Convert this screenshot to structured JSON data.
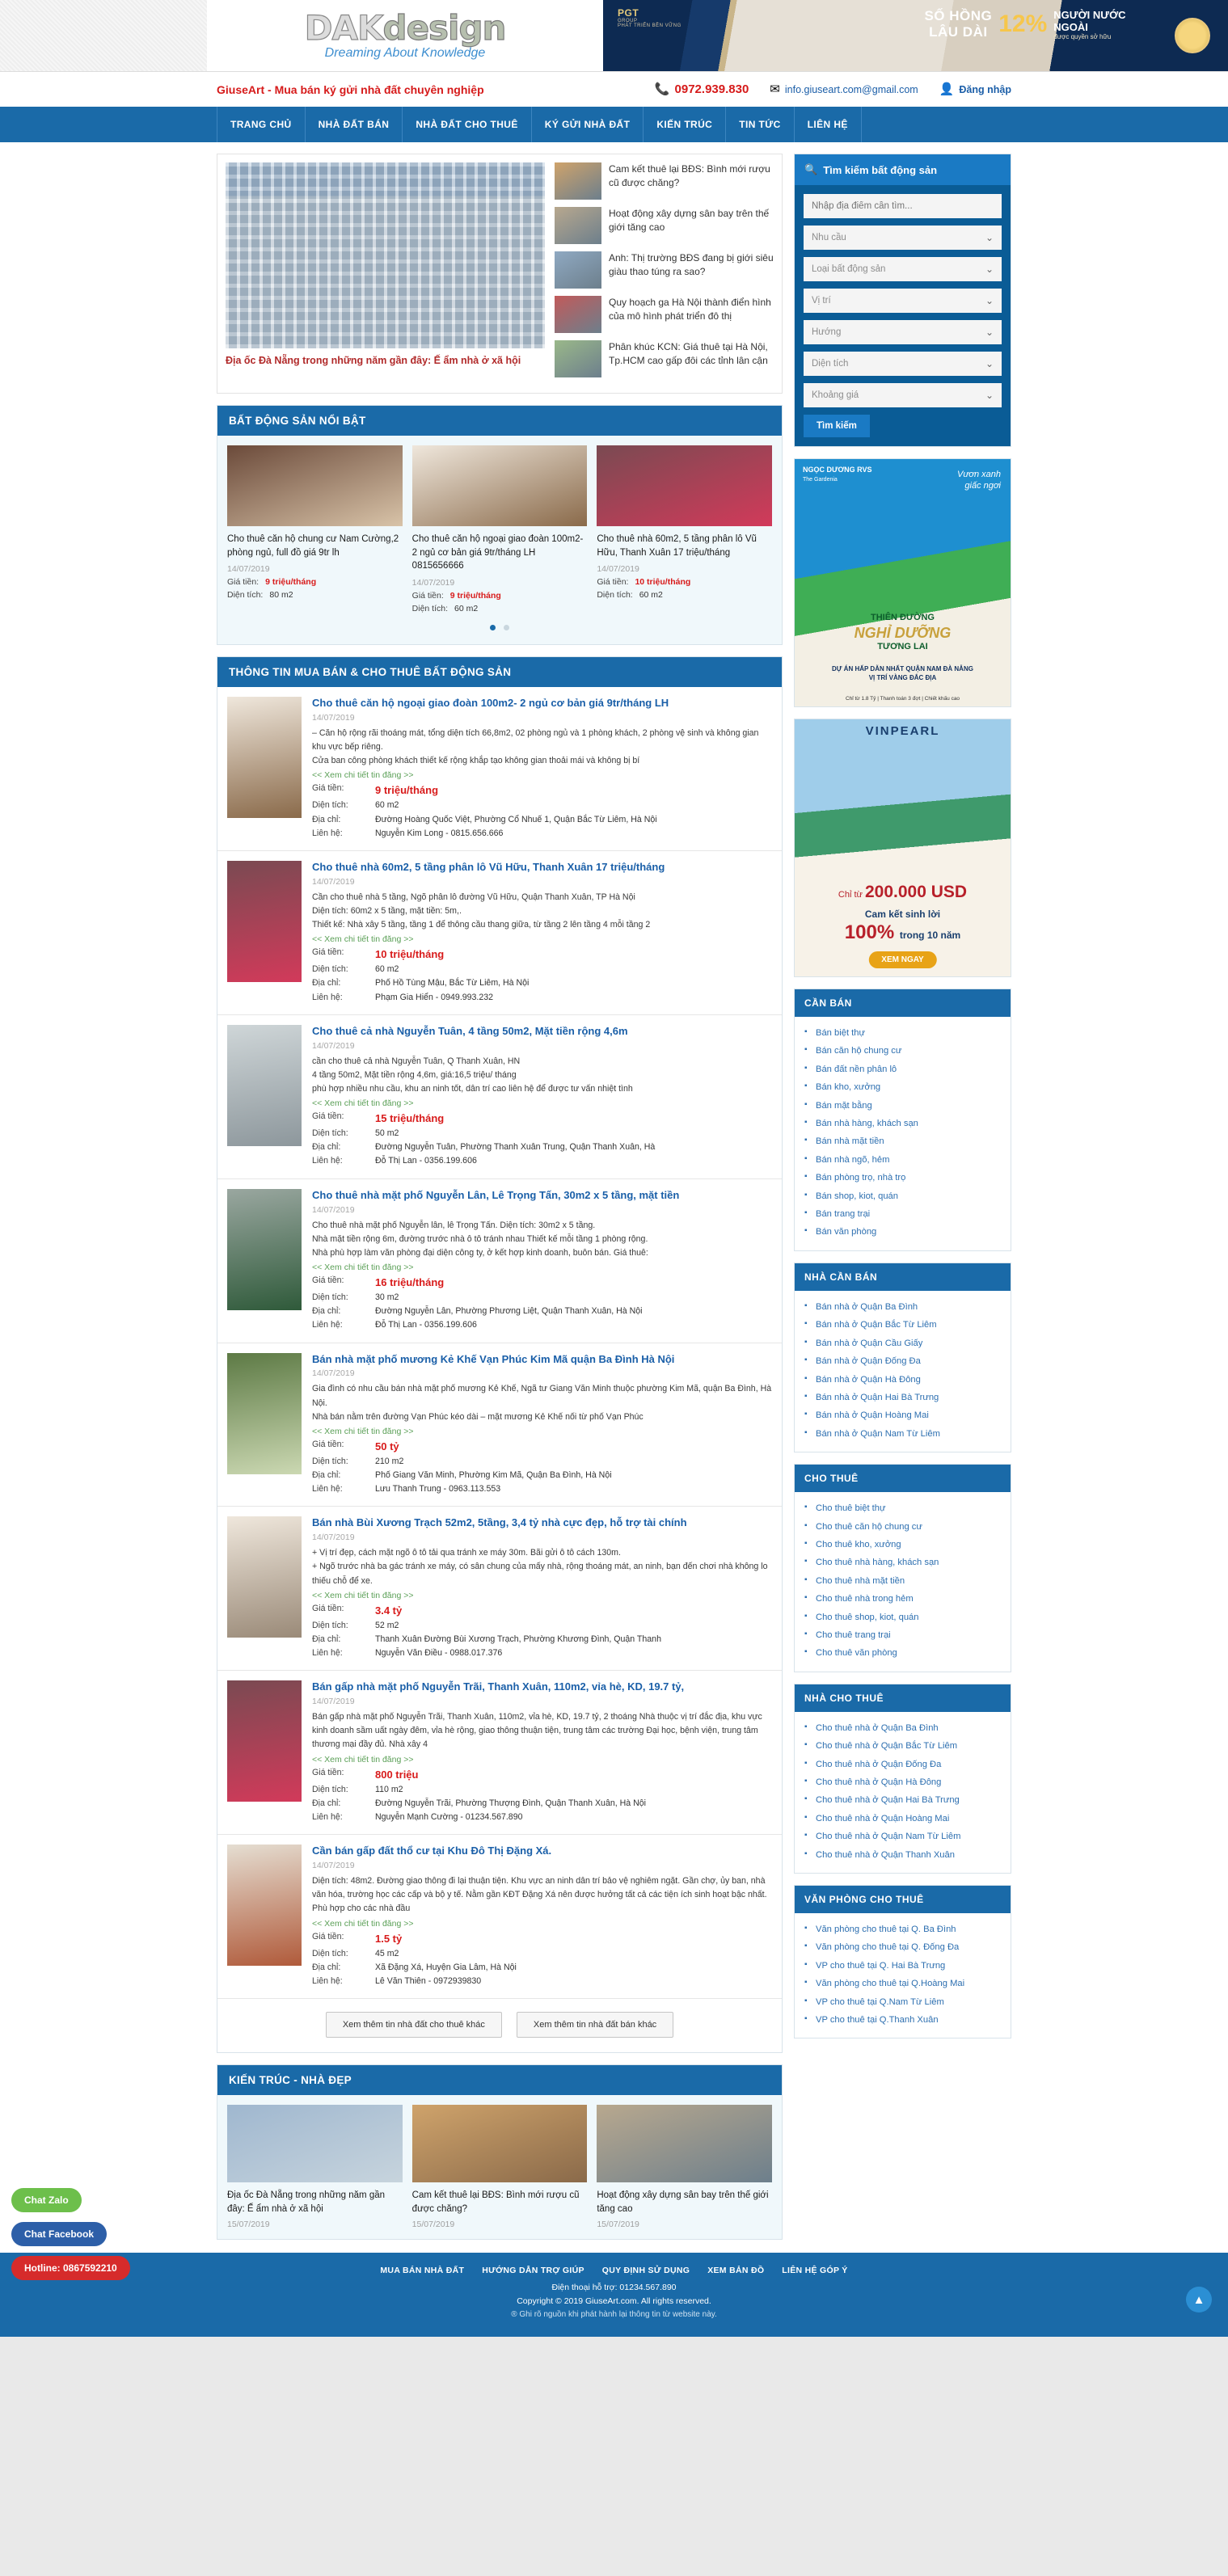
{
  "site": {
    "logo_main_a": "DAK",
    "logo_main_b": "design",
    "logo_sub": "Dreaming About Knowledge"
  },
  "banner": {
    "brand": "PGT",
    "brand_sub": "GROUP",
    "brand_tagline": "PHÁT TRIỂN BỀN VỮNG",
    "line1": "SỐ HỒNG",
    "line2": "LÂU DÀI",
    "big_number": "12%",
    "right_line1": "NGƯỜI NƯỚC",
    "right_line2": "NGOÀI",
    "right_sub": "được quyền sở hữu"
  },
  "contact": {
    "slogan": "GiuseArt - Mua bán ký gửi nhà đất chuyên nghiệp",
    "phone_icon": "phone-icon",
    "phone": "0972.939.830",
    "mail_icon": "mail-icon",
    "email": "info.giuseart.com@gmail.com",
    "user_icon": "user-icon",
    "login": "Đăng nhập"
  },
  "nav": {
    "items": [
      {
        "label": "TRANG CHỦ"
      },
      {
        "label": "NHÀ ĐẤT BÁN"
      },
      {
        "label": "NHÀ ĐẤT CHO THUÊ"
      },
      {
        "label": "KÝ GỬI NHÀ ĐẤT"
      },
      {
        "label": "KIẾN TRÚC"
      },
      {
        "label": "TIN TỨC"
      },
      {
        "label": "LIÊN HỆ"
      }
    ]
  },
  "hero": {
    "main_caption": "Địa ốc Đà Nẵng trong những năm gần đây: Ế ẩm nhà ở xã hội",
    "news": [
      {
        "title": "Cam kết thuê lại BĐS: Bình mới rượu cũ được chăng?"
      },
      {
        "title": "Hoạt động xây dựng sân bay trên thế giới tăng cao"
      },
      {
        "title": "Anh: Thị trường BĐS đang bị giới siêu giàu thao túng ra sao?"
      },
      {
        "title": "Quy hoạch ga Hà Nội thành điển hình của mô hình phát triển đô thị"
      },
      {
        "title": "Phân khúc KCN: Giá thuê tại Hà Nội, Tp.HCM cao gấp đôi các tỉnh lân cận"
      }
    ]
  },
  "featured": {
    "heading": "BẤT ĐỘNG SẢN NỔI BẬT",
    "price_label": "Giá tiền:",
    "area_label": "Diện tích:",
    "cards": [
      {
        "title": "Cho thuê căn hộ chung cư Nam Cường,2 phòng ngủ, full đồ giá 9tr lh",
        "date": "14/07/2019",
        "price": "9 triệu/tháng",
        "area": "80 m2"
      },
      {
        "title": "Cho thuê căn hộ ngoại giao đoàn 100m2- 2 ngủ cơ bản giá 9tr/tháng LH 0815656666",
        "date": "14/07/2019",
        "price": "9 triệu/tháng",
        "area": "60 m2"
      },
      {
        "title": "Cho thuê nhà 60m2, 5 tầng phân lô Vũ Hữu, Thanh Xuân 17 triệu/tháng",
        "date": "14/07/2019",
        "price": "10 triệu/tháng",
        "area": "60 m2"
      }
    ]
  },
  "listings": {
    "heading": "THÔNG TIN MUA BÁN & CHO THUÊ BẤT ĐỘNG SẢN",
    "more_link": "<< Xem chi tiết tin đăng >>",
    "labels": {
      "price": "Giá tiền:",
      "area": "Diện tích:",
      "address": "Địa chỉ:",
      "contact": "Liên hệ:"
    },
    "items": [
      {
        "title": "Cho thuê căn hộ ngoại giao đoàn 100m2- 2 ngủ cơ bản giá 9tr/tháng LH",
        "date": "14/07/2019",
        "desc": "– Căn hộ rộng rãi thoáng mát, tổng diện tích 66,8m2, 02 phòng ngủ và 1 phòng khách, 2 phòng vệ sinh và không gian khu vực bếp riêng.\nCửa ban công phòng khách thiết kế rộng khắp tạo không gian thoải mái và không bị bí",
        "price": "9 triệu/tháng",
        "area": "60 m2",
        "address": "Đường Hoàng Quốc Việt, Phường Cổ Nhuế 1, Quận Bắc Từ Liêm, Hà Nội",
        "contact": "Nguyễn Kim Long - 0815.656.666"
      },
      {
        "title": "Cho thuê nhà 60m2, 5 tầng phân lô Vũ Hữu, Thanh Xuân 17 triệu/tháng",
        "date": "14/07/2019",
        "desc": "Cần cho thuê nhà 5 tầng, Ngõ phân lô đường Vũ Hữu, Quận Thanh Xuân, TP Hà Nội\nDiện tích: 60m2 x 5 tầng, mặt tiền: 5m,.\nThiết kế: Nhà xây 5 tầng, tầng 1 để thông cầu thang giữa, từ tầng 2 lên tầng 4 mỗi tầng 2",
        "price": "10 triệu/tháng",
        "area": "60 m2",
        "address": "Phố Hồ Tùng Mậu, Bắc Từ Liêm, Hà Nội",
        "contact": "Phạm Gia Hiển - 0949.993.232"
      },
      {
        "title": "Cho thuê cả nhà Nguyễn Tuân, 4 tầng 50m2, Mặt tiền rộng 4,6m",
        "date": "14/07/2019",
        "desc": "cần cho thuê cả nhà Nguyễn Tuân, Q Thanh Xuân, HN\n4 tầng 50m2, Mặt tiền rộng 4,6m, giá:16,5 triệu/ tháng\nphù hợp nhiều nhu cầu, khu an ninh tốt, dân trí cao liên hệ để được tư vấn nhiệt tình",
        "price": "15 triệu/tháng",
        "area": "50 m2",
        "address": "Đường Nguyễn Tuân, Phường Thanh Xuân Trung, Quận Thanh Xuân, Hà",
        "contact": "Đỗ Thị Lan - 0356.199.606"
      },
      {
        "title": "Cho thuê nhà mặt phố Nguyễn Lân, Lê Trọng Tấn, 30m2 x 5 tầng, mặt tiền",
        "date": "14/07/2019",
        "desc": "Cho thuê nhà mặt phố Nguyễn lân, lê Trọng Tấn. Diện tích: 30m2 x 5 tầng.\nNhà mặt tiền rộng 6m, đường trước nhà ô tô tránh nhau Thiết kế mỗi tầng 1 phòng rộng.\nNhà phù hợp làm văn phòng đại diện công ty, ở kết hợp kinh doanh, buôn bán. Giá thuê:",
        "price": "16 triệu/tháng",
        "area": "30 m2",
        "address": "Đường Nguyễn Lân, Phường Phương Liệt, Quận Thanh Xuân, Hà Nội",
        "contact": "Đỗ Thị Lan - 0356.199.606"
      },
      {
        "title": "Bán nhà mặt phố mương Kẻ Khế Vạn Phúc Kim Mã quận Ba Đình Hà Nội",
        "date": "14/07/2019",
        "desc": "Gia đình có nhu cầu bán nhà mặt phố mương Kẻ Khế, Ngã tư Giang Văn Minh thuộc phường Kim Mã, quận Ba Đình, Hà Nội.\nNhà bán nằm trên đường Vạn Phúc kéo dài – mặt mương Kẻ Khế nối từ phố Vạn Phúc",
        "price": "50 tỷ",
        "area": "210 m2",
        "address": "Phố Giang Văn Minh, Phường Kim Mã, Quận Ba Đình, Hà Nội",
        "contact": "Lưu Thanh Trung - 0963.113.553"
      },
      {
        "title": "Bán nhà Bùi Xương Trạch 52m2, 5tầng, 3,4 tỷ nhà cực đẹp, hỗ trợ tài chính",
        "date": "14/07/2019",
        "desc": "+ Vị trí đẹp, cách mặt ngõ ô tô tải qua tránh xe máy 30m. Bãi gửi ô tô cách 130m.\n+ Ngõ trước nhà ba gác tránh xe máy, có sân chung của mấy nhà, rộng thoáng mát, an ninh, bạn đến chơi nhà không lo thiếu chỗ để xe.",
        "price": "3.4 tỷ",
        "area": "52 m2",
        "address": "Thanh Xuân Đường Bùi Xương Trạch, Phường Khương Đình, Quận Thanh",
        "contact": "Nguyễn Văn Điều - 0988.017.376"
      },
      {
        "title": "Bán gấp nhà mặt phố Nguyễn Trãi, Thanh Xuân, 110m2, vỉa hè, KD, 19.7 tỷ,",
        "date": "14/07/2019",
        "desc": "Bán gấp nhà mặt phố Nguyễn Trãi, Thanh Xuân, 110m2, vỉa hè, KD, 19.7 tỷ, 2 thoáng Nhà thuộc vị trí đắc địa, khu vực kinh doanh sầm uất ngày đêm, vỉa hè rộng, giao thông thuận tiện, trung tâm các trường Đại học, bệnh viện, trung tâm thương mại đầy đủ. Nhà xây 4",
        "price": "800 triệu",
        "area": "110 m2",
        "address": "Đường Nguyễn Trãi, Phường Thượng Đình, Quận Thanh Xuân, Hà Nội",
        "contact": "Nguyễn Mạnh Cường - 01234.567.890"
      },
      {
        "title": "Cần bán gấp đất thổ cư tại Khu Đô Thị Đặng Xá.",
        "date": "14/07/2019",
        "desc": "Diện tích: 48m2. Đường giao thông đi lại thuận tiện. Khu vực an ninh dân trí bảo vệ nghiêm ngặt. Gần chợ, ủy ban, nhà văn hóa, trường học các cấp và bộ y tế. Nằm gần KĐT Đặng Xá nên được hưởng tất cả các tiện ích sinh hoạt bậc nhất. Phù hợp cho các nhà đầu",
        "price": "1.5 tỷ",
        "area": "45 m2",
        "address": "Xã Đặng Xá, Huyện Gia Lâm, Hà Nội",
        "contact": "Lê Văn Thiên - 0972939830"
      }
    ],
    "btn_rent": "Xem thêm tin nhà đất cho thuê khác",
    "btn_sale": "Xem thêm tin nhà đất bán khác"
  },
  "architecture": {
    "heading": "KIẾN TRÚC - NHÀ ĐẸP",
    "cards": [
      {
        "title": "Địa ốc Đà Nẵng trong những năm gần đây: Ế ẩm nhà ở xã hội",
        "date": "15/07/2019"
      },
      {
        "title": "Cam kết thuê lại BĐS: Bình mới rượu cũ được chăng?",
        "date": "15/07/2019"
      },
      {
        "title": "Hoạt động xây dựng sân bay trên thế giới tăng cao",
        "date": "15/07/2019"
      }
    ]
  },
  "search": {
    "heading": "Tìm kiếm bất động sản",
    "icon": "search-icon",
    "placeholder": "Nhập địa điểm cần tìm...",
    "selects": [
      {
        "label": "Nhu cầu"
      },
      {
        "label": "Loại bất động sản"
      },
      {
        "label": "Vị trí"
      },
      {
        "label": "Hướng"
      },
      {
        "label": "Diện tích"
      },
      {
        "label": "Khoảng giá"
      }
    ],
    "button": "Tìm kiếm"
  },
  "ads": {
    "ad1": {
      "brand": "NGỌC DƯƠNG RVS",
      "brand_sub": "The Gardenia",
      "tag1": "Vươn xanh",
      "tag2": "giấc ngơi",
      "head1": "THIÊN ĐƯỜNG",
      "head2": "NGHỈ DƯỠNG",
      "head3": "TƯƠNG LAI",
      "sub1": "DỰ ÁN HẤP DẪN NHẤT QUẬN NAM ĐÀ NẴNG",
      "sub2": "VỊ TRÍ VÀNG ĐẮC ĐỊA",
      "foot": "Chỉ từ 1.8 Tỷ | Thanh toán 3 đợt | Chiết khấu cao"
    },
    "ad2": {
      "brand": "VINPEARL",
      "price_label": "Chỉ từ",
      "price": "200.000 USD",
      "line1": "Cam kết sinh lời",
      "pct": "100%",
      "years": "trong 10 năm",
      "cta": "XEM NGAY"
    }
  },
  "sidebar_categories": [
    {
      "heading": "CẦN BÁN",
      "items": [
        "Bán biệt thự",
        "Bán căn hộ chung cư",
        "Bán đất nền phân lô",
        "Bán kho, xưởng",
        "Bán mặt bằng",
        "Bán nhà hàng, khách sạn",
        "Bán nhà mặt tiền",
        "Bán nhà ngõ, hẻm",
        "Bán phòng trọ, nhà trọ",
        "Bán shop, kiot, quán",
        "Bán trang trại",
        "Bán văn phòng"
      ]
    },
    {
      "heading": "NHÀ CẦN BÁN",
      "items": [
        "Bán nhà ở Quận Ba Đình",
        "Bán nhà ở Quận Bắc Từ Liêm",
        "Bán nhà ở Quận Cầu Giấy",
        "Bán nhà ở Quận Đống Đa",
        "Bán nhà ở Quận Hà Đông",
        "Bán nhà ở Quận Hai Bà Trưng",
        "Bán nhà ở Quận Hoàng Mai",
        "Bán nhà ở Quận Nam Từ Liêm"
      ]
    },
    {
      "heading": "CHO THUÊ",
      "items": [
        "Cho thuê biệt thự",
        "Cho thuê căn hộ chung cư",
        "Cho thuê kho, xưởng",
        "Cho thuê nhà hàng, khách sạn",
        "Cho thuê nhà mặt tiền",
        "Cho thuê nhà trong hẻm",
        "Cho thuê shop, kiot, quán",
        "Cho thuê trang trại",
        "Cho thuê văn phòng"
      ]
    },
    {
      "heading": "NHÀ CHO THUÊ",
      "items": [
        "Cho thuê nhà ở Quận Ba Đình",
        "Cho thuê nhà ở Quận Bắc Từ Liêm",
        "Cho thuê nhà ở Quận Đống Đa",
        "Cho thuê nhà ở Quận Hà Đông",
        "Cho thuê nhà ở Quận Hai Bà Trưng",
        "Cho thuê nhà ở Quận Hoàng Mai",
        "Cho thuê nhà ở Quận Nam Từ Liêm",
        "Cho thuê nhà ở Quận Thanh Xuân"
      ]
    },
    {
      "heading": "VĂN PHÒNG CHO THUÊ",
      "items": [
        "Văn phòng cho thuê tại Q. Ba Đình",
        "Văn phòng cho thuê tại Q. Đống Đa",
        "VP cho thuê tại Q. Hai Bà Trưng",
        "Văn phòng cho thuê tại Q.Hoàng Mai",
        "VP cho thuê tại Q.Nam Từ Liêm",
        "VP cho thuê tại Q.Thanh Xuân"
      ]
    }
  ],
  "footer": {
    "nav": [
      "MUA BÁN NHÀ ĐẤT",
      "HƯỚNG DẪN TRỢ GIÚP",
      "QUY ĐỊNH SỬ DỤNG",
      "XEM BẢN ĐỒ",
      "LIÊN HỆ GÓP Ý"
    ],
    "hotline": "Điện thoại hỗ trợ: 01234.567.890",
    "copyright": "Copyright © 2019 GiuseArt.com. All rights reserved.",
    "note": "® Ghi rõ nguồn khi phát hành lại thông tin từ website này."
  },
  "floating": {
    "zalo": "Chat Zalo",
    "facebook": "Chat Facebook",
    "hotline": "Hotline: 0867592210",
    "totop": "to-top-icon"
  }
}
